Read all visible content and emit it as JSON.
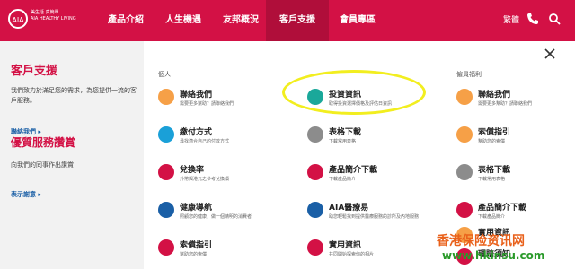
{
  "brand": {
    "logo_text": "友邦保險\nAIA",
    "name_line1": "美生活 真簡單",
    "name_line2": "AIA HEALTHY LIVING"
  },
  "nav": {
    "items": [
      "產品介紹",
      "人生機遇",
      "友邦概況",
      "客戶支援",
      "會員專區"
    ],
    "active": "客戶支援",
    "lang": "繁體"
  },
  "left": {
    "title": "客戶支援",
    "desc": "我們致力於滿足您的需求，為您提供一流的客戶服務。",
    "contact_link": "聯絡我們 ▸",
    "service_title": "優質服務讚賞",
    "service_sub": "向我們的同事作出讚賞",
    "thanks_link": "表示謝意 ▸"
  },
  "columns": {
    "personal_head": "個人",
    "benefits_head": "僱員福利"
  },
  "personal": [
    {
      "title": "聯絡我們",
      "sub": "需要更多幫助？請聯絡我們",
      "color": "#f6a047"
    },
    {
      "title": "繳付方式",
      "sub": "尋找適合自己的付款方式",
      "color": "#1aa0d8"
    },
    {
      "title": "兌換率",
      "sub": "外幣與港元之參考兌換價",
      "color": "#d31145"
    },
    {
      "title": "健康導航",
      "sub": "照顧您的健康，做一個精明的消費者",
      "color": "#1a5fa6"
    },
    {
      "title": "索償指引",
      "sub": "幫助您的索償",
      "color": "#d31145"
    }
  ],
  "middle": [
    {
      "title": "投資資訊",
      "sub": "取得投資選擇價格及評估日資訊",
      "color": "#1aa89a"
    },
    {
      "title": "表格下載",
      "sub": "下載常用表格",
      "color": "#8c8c8c"
    },
    {
      "title": "產品簡介下載",
      "sub": "下載產品簡介",
      "color": "#d31145"
    },
    {
      "title": "AIA醫療易",
      "sub": "助您輕鬆找到提供醫療服務的診所及內地服務",
      "color": "#1a5fa6"
    },
    {
      "title": "實用資訊",
      "sub": "共同開始探索你的相片",
      "color": "#d31145"
    }
  ],
  "benefits": [
    {
      "title": "聯絡我們",
      "sub": "需要更多幫助？請聯絡我們",
      "color": "#f6a047"
    },
    {
      "title": "索償指引",
      "sub": "幫助您的索償",
      "color": "#f6a047"
    },
    {
      "title": "表格下載",
      "sub": "下載常用表格",
      "color": "#8c8c8c"
    },
    {
      "title": "產品簡介下載",
      "sub": "下載產品簡介",
      "color": "#d31145"
    },
    {
      "title": "實用資訊",
      "sub": "",
      "color": "#f6a047"
    },
    {
      "title": "理賠須知",
      "sub": "",
      "color": "#d31145"
    }
  ],
  "watermark": {
    "line1": "香港保险资讯网",
    "line2": "www.hkinsu.com"
  }
}
